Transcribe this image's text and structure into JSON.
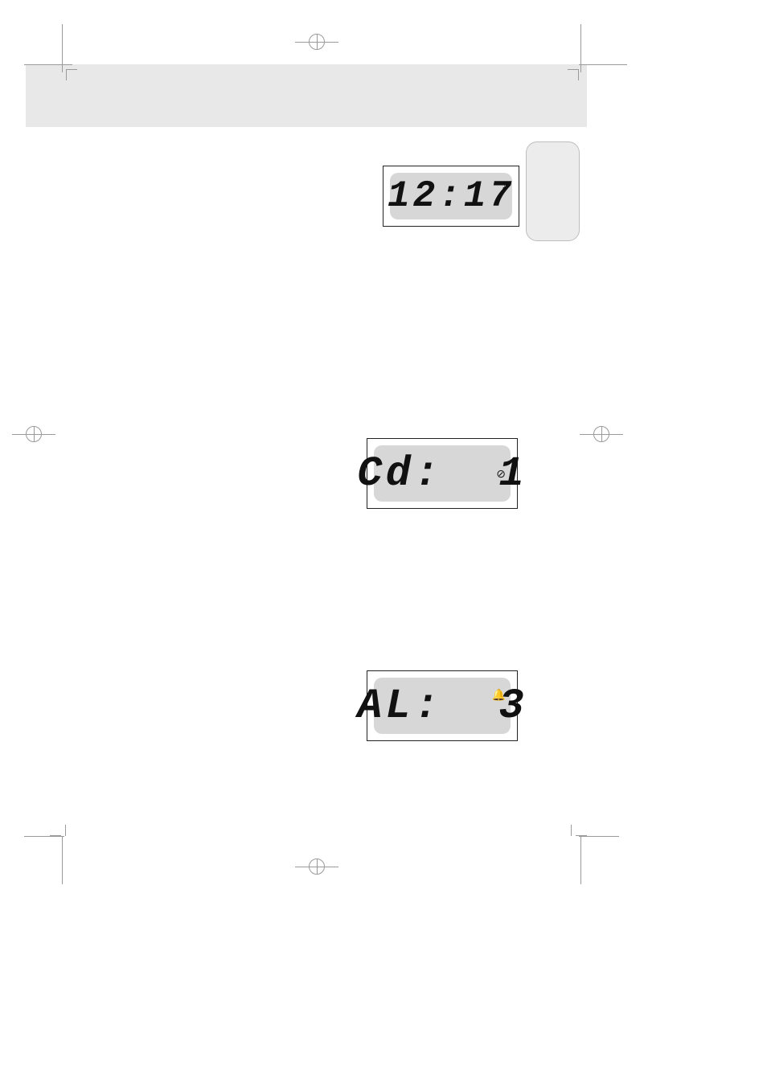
{
  "header": {},
  "tab": {},
  "lcd1": {
    "text": "12:17",
    "icon": "♪"
  },
  "lcd2": {
    "text": "Cd:  1",
    "icon": "⊘"
  },
  "lcd3": {
    "text": "AL:  3",
    "icon": "🔔"
  }
}
